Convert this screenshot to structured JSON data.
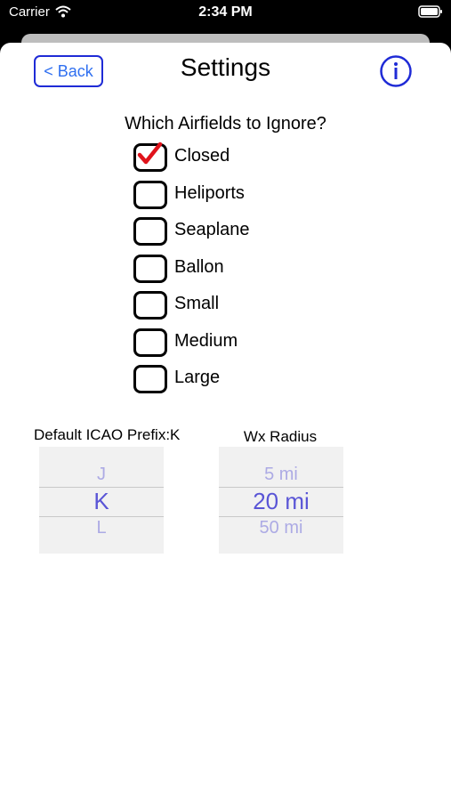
{
  "status_bar": {
    "carrier": "Carrier",
    "time": "2:34 PM"
  },
  "nav": {
    "back_label": "< Back",
    "title": "Settings"
  },
  "filter": {
    "question": "Which Airfields to Ignore?",
    "options": [
      {
        "label": "Closed",
        "checked": true
      },
      {
        "label": "Heliports",
        "checked": false
      },
      {
        "label": "Seaplane",
        "checked": false
      },
      {
        "label": "Ballon",
        "checked": false
      },
      {
        "label": "Small",
        "checked": false
      },
      {
        "label": "Medium",
        "checked": false
      },
      {
        "label": "Large",
        "checked": false
      }
    ]
  },
  "icao_picker": {
    "label": "Default ICAO Prefix:K",
    "above": "J",
    "selected": "K",
    "below": "L"
  },
  "radius_picker": {
    "label": "Wx Radius",
    "above": "5 mi",
    "selected": "20 mi",
    "below": "50 mi"
  },
  "colors": {
    "accent": "#1f2bd6",
    "link": "#2f6ff0",
    "check": "#e0131b",
    "picker_text": "#5a55d6"
  }
}
